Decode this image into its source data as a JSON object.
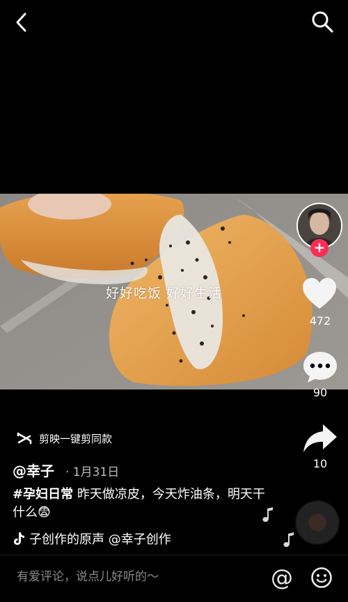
{
  "top_bar": {
    "back_icon": "back-arrow-icon",
    "search_icon": "search-icon"
  },
  "video": {
    "overlay_text": "好好吃饭 好好生活"
  },
  "rail": {
    "likes": "472",
    "comments": "90",
    "shares": "10",
    "follow_glyph": "+"
  },
  "capcut": {
    "label": "剪映一键剪同款"
  },
  "post": {
    "author": "@幸子",
    "date": "· 1月31日",
    "hashtag": "#孕妇日常",
    "text": " 昨天做凉皮，今天炸油条，明天干什么😨"
  },
  "music": {
    "label": "子创作的原声    @幸子创作"
  },
  "comment_bar": {
    "placeholder": "有爱评论，说点儿好听的～",
    "at_glyph": "@"
  },
  "colors": {
    "background": "#000000",
    "follow_red": "#fe2c55"
  }
}
